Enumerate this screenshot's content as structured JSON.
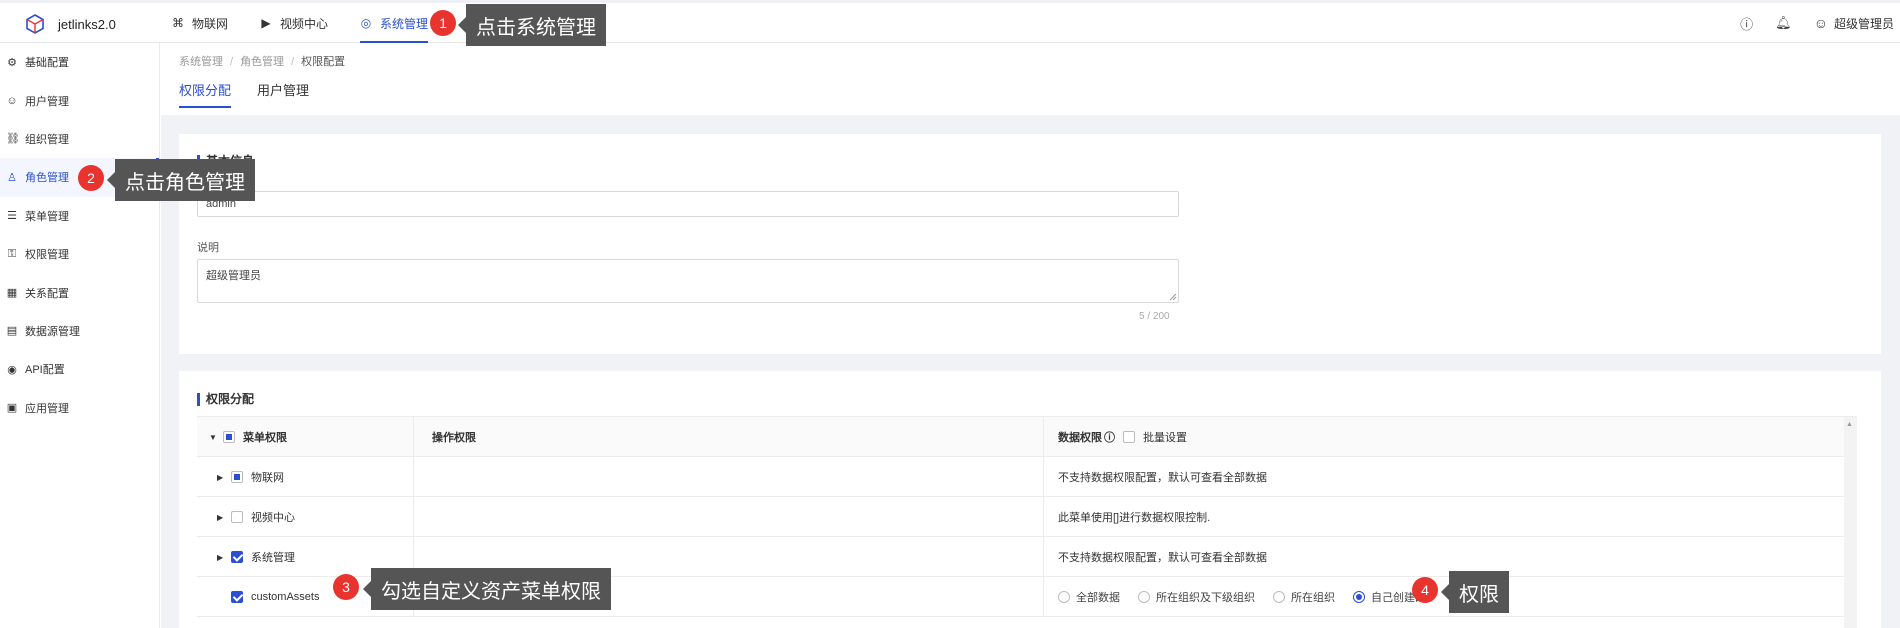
{
  "app": {
    "name": "jetlinks2.0"
  },
  "topnav": [
    {
      "label": "物联网",
      "icon": "iot-icon",
      "glyph": "⌘",
      "active": false
    },
    {
      "label": "视频中心",
      "icon": "video-icon",
      "glyph": "▶",
      "active": false
    },
    {
      "label": "系统管理",
      "icon": "system-icon",
      "glyph": "◎",
      "active": true
    }
  ],
  "header_right": {
    "user": "超级管理员"
  },
  "sidebar": [
    {
      "label": "基础配置",
      "icon": "gear-icon",
      "glyph": "⚙"
    },
    {
      "label": "用户管理",
      "icon": "users-icon",
      "glyph": "☺"
    },
    {
      "label": "组织管理",
      "icon": "org-icon",
      "glyph": "⛓"
    },
    {
      "label": "角色管理",
      "icon": "role-icon",
      "glyph": "♙",
      "active": true
    },
    {
      "label": "菜单管理",
      "icon": "menu-icon",
      "glyph": "☰"
    },
    {
      "label": "权限管理",
      "icon": "permission-icon",
      "glyph": "⚿"
    },
    {
      "label": "关系配置",
      "icon": "relation-icon",
      "glyph": "▦"
    },
    {
      "label": "数据源管理",
      "icon": "datasource-icon",
      "glyph": "▤"
    },
    {
      "label": "API配置",
      "icon": "api-icon",
      "glyph": "◉"
    },
    {
      "label": "应用管理",
      "icon": "app-icon",
      "glyph": "▣"
    }
  ],
  "breadcrumb": [
    "系统管理",
    "角色管理",
    "权限配置"
  ],
  "tabs": [
    {
      "label": "权限分配",
      "active": true
    },
    {
      "label": "用户管理",
      "active": false
    }
  ],
  "basic": {
    "title": "基本信息",
    "name_value": "admin",
    "desc_label": "说明",
    "desc_value": "超级管理员",
    "counter": "5 / 200"
  },
  "perm": {
    "title": "权限分配",
    "headers": {
      "menu": "菜单权限",
      "op": "操作权限",
      "data": "数据权限",
      "batch": "批量设置"
    },
    "rows": [
      {
        "name": "物联网",
        "data": "不支持数据权限配置，默认可查看全部数据"
      },
      {
        "name": "视频中心",
        "data": "此菜单使用[]进行数据权限控制."
      },
      {
        "name": "系统管理",
        "data": "不支持数据权限配置，默认可查看全部数据"
      },
      {
        "name": "customAssets"
      }
    ],
    "radio_options": [
      "全部数据",
      "所在组织及下级组织",
      "所在组织",
      "自己创建的"
    ]
  },
  "callouts": [
    {
      "num": "1",
      "text": "点击系统管理"
    },
    {
      "num": "2",
      "text": "点击角色管理"
    },
    {
      "num": "3",
      "text": "勾选自定义资产菜单权限"
    },
    {
      "num": "4",
      "text": "权限"
    }
  ],
  "colors": {
    "accent": "#2b4fd1",
    "badge": "#e8332f",
    "tooltip": "#555555"
  }
}
